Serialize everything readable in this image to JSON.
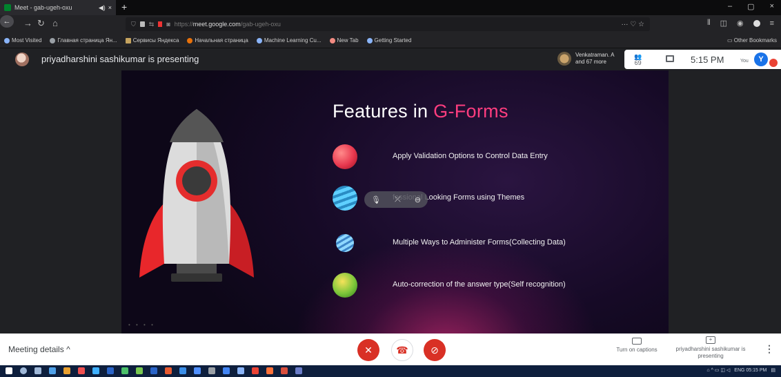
{
  "browser": {
    "tab_title": "Meet - gab-ugeh-oxu",
    "tab_audio_icon": "speaker-icon",
    "tab_close_glyph": "×",
    "new_tab_glyph": "+",
    "url_domain": "meet.google.com",
    "url_path": "/gab-ugeh-oxu",
    "url_prefix": "https://",
    "url_actions": "··· ♡ ☆",
    "window_controls": [
      "–",
      "▢",
      "×"
    ]
  },
  "bookmarks": {
    "items": [
      {
        "label": "Most Visited",
        "color": "#8ab4f8"
      },
      {
        "label": "Главная страница Ян...",
        "color": "#9aa0a6"
      },
      {
        "label": "Сервисы Яндекса",
        "color": "#c5a35f"
      },
      {
        "label": "Начальная страница",
        "color": "#e8710a"
      },
      {
        "label": "Machine Learning Cu...",
        "color": "#8ab4f8"
      },
      {
        "label": "New Tab",
        "color": "#f28b82"
      },
      {
        "label": "Getting Started",
        "color": "#8ab4f8"
      }
    ],
    "other": "Other Bookmarks"
  },
  "meet": {
    "presenting_banner": "priyadharshini sashikumar is presenting",
    "participants_text_line1": "Venkatraman. A",
    "participants_text_line2": "and 67 more",
    "people_count": "69",
    "time": "5:15 PM",
    "you_label": "You",
    "user_initial": "Y",
    "meeting_details": "Meeting details",
    "captions_label": "Turn on captions",
    "presenting_info": "priyadharshini sashikumar is presenting"
  },
  "slide": {
    "title_main": "Features in ",
    "title_accent": "G-Forms",
    "features": [
      {
        "text": "Apply Validation Options to Control Data Entry",
        "color": "#e8384f"
      },
      {
        "text": "fessional Looking Forms using Themes",
        "color": "#3ab0e0"
      },
      {
        "text": "Multiple Ways to Administer Forms(Collecting Data)",
        "color": "#4aa0e0"
      },
      {
        "text": "Auto-correction of the answer type(Self recognition)",
        "color": "#7cc63a"
      }
    ]
  },
  "taskbar": {
    "tray_text": "ENG 05:15 PM"
  },
  "colors": {
    "accent": "#ff3d7f",
    "meet_red": "#d93025",
    "meet_blue": "#1a73e8"
  }
}
